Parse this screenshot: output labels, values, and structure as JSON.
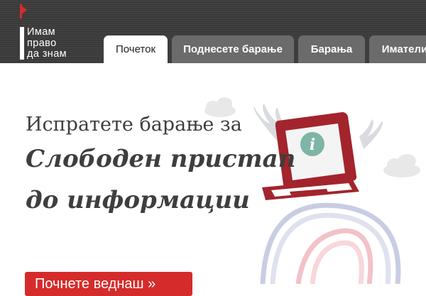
{
  "logo": {
    "line1": "Имам",
    "line2": "право",
    "line3": "да знам"
  },
  "nav": {
    "tabs": [
      {
        "label": "Почеток",
        "active": true
      },
      {
        "label": "Поднесете барање",
        "active": false
      },
      {
        "label": "Барања",
        "active": false
      },
      {
        "label": "Иматели",
        "active": false
      }
    ]
  },
  "hero": {
    "line1": "Испратете барање за",
    "line2": "Слободен пристап",
    "line3": "до информации",
    "cta_label": "Почнете веднаш »"
  },
  "illustration": {
    "info_glyph": "i"
  },
  "colors": {
    "header_bg": "#3a3a3a",
    "tab_inactive": "#6b6b6b",
    "brand_red": "#d62b2b",
    "laptop_red": "#a3242c",
    "info_teal": "#7fb5a6"
  },
  "icons": [
    "red-flag-icon",
    "info-icon",
    "laptop-icon",
    "wings-icon",
    "cloud-icon"
  ]
}
